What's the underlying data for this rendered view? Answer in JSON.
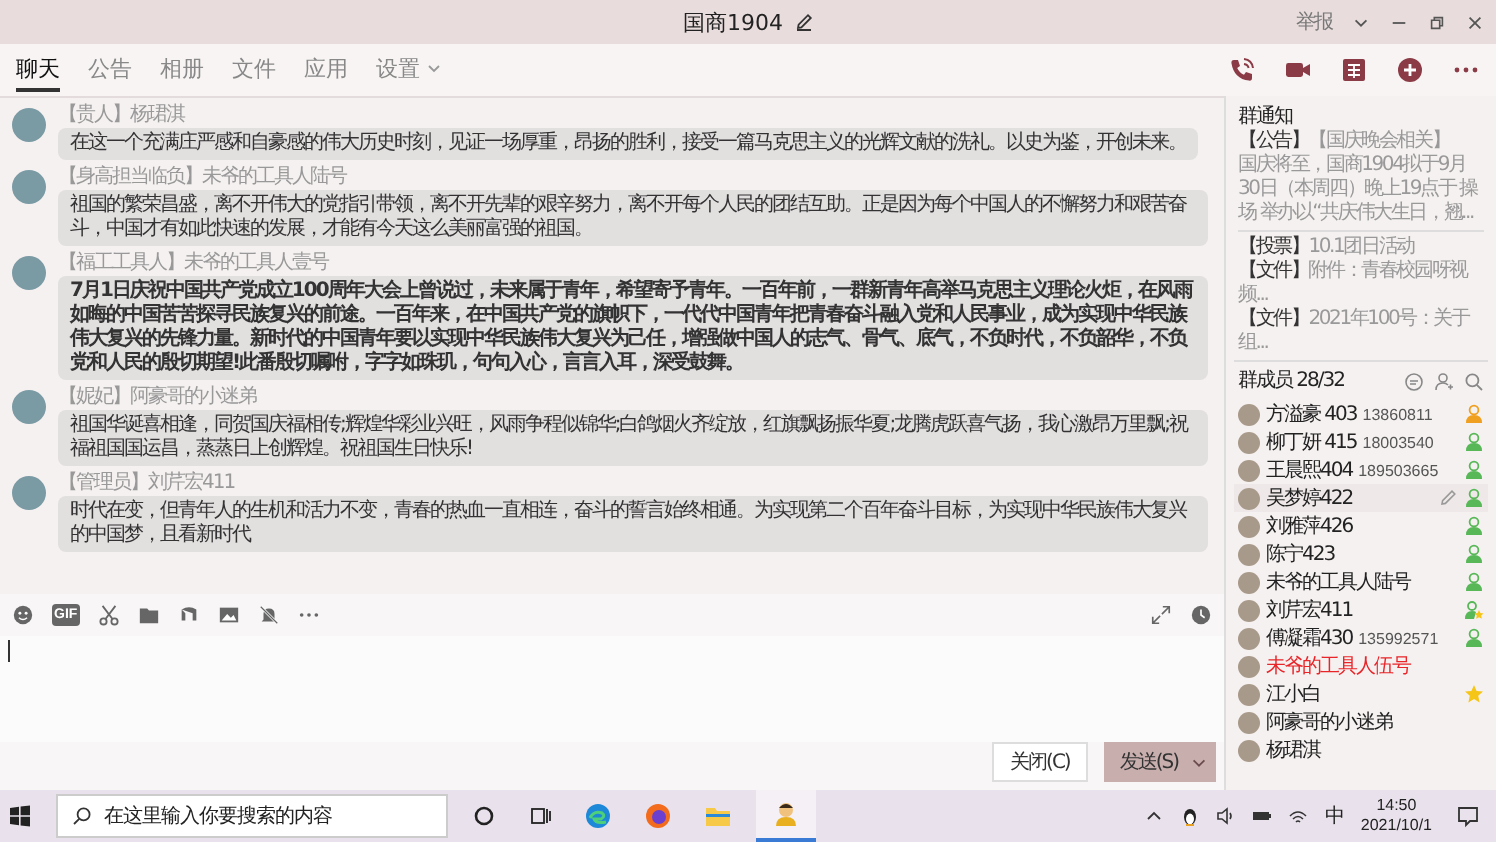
{
  "window": {
    "title": "国商1904",
    "report": "举报"
  },
  "tabs": [
    {
      "label": "聊天",
      "selected": true,
      "dropdown": false
    },
    {
      "label": "公告",
      "selected": false,
      "dropdown": false
    },
    {
      "label": "相册",
      "selected": false,
      "dropdown": false
    },
    {
      "label": "文件",
      "selected": false,
      "dropdown": false
    },
    {
      "label": "应用",
      "selected": false,
      "dropdown": false
    },
    {
      "label": "设置",
      "selected": false,
      "dropdown": true
    }
  ],
  "messages": [
    {
      "sender": "【贵人】杨珺淇",
      "text": "在这一个充满庄严感和自豪感的伟大历史时刻，见证一场厚重，昂扬的胜利，接受一篇马克思主义的光辉文献的洗礼。以史为鉴，开创未来。",
      "bold": false
    },
    {
      "sender": "【身高担当临负】未爷的工具人陆号",
      "text": "祖国的繁荣昌盛，离不开伟大的党指引带领，离不开先辈的艰辛努力，离不开每个人民的团结互助。正是因为每个中国人的不懈努力和艰苦奋斗，中国才有如此快速的发展，才能有今天这么美丽富强的祖国。",
      "bold": false
    },
    {
      "sender": "【福工工具人】未爷的工具人壹号",
      "text": "7月1日庆祝中国共产党成立100周年大会上曾说过，未来属于青年，希望寄予青年。一百年前，一群新青年高举马克思主义理论火炬，在风雨如晦的中国苦苦探寻民族复兴的前途。一百年来，在中国共产党的旗帜下，一代代中国青年把青春奋斗融入党和人民事业，成为实现中华民族伟大复兴的先锋力量。新时代的中国青年要以实现中华民族伟大复兴为己任，增强做中国人的志气、骨气、底气，不负时代，不负韶华，不负党和人民的殷切期望!此番殷切嘱咐，字字如珠玑，句句入心，言言入耳，深受鼓舞。",
      "bold": true
    },
    {
      "sender": "【妮妃】阿豪哥的小迷弟",
      "text": "祖国华诞喜相逢，同贺国庆福相传;辉煌华彩业兴旺，风雨争程似锦华;白鸽烟火齐绽放，红旗飘扬振华夏;龙腾虎跃喜气扬，我心激昂万里飘;祝福祖国国运昌，蒸蒸日上创辉煌。祝祖国生日快乐!",
      "bold": false
    },
    {
      "sender": "【管理员】刘芹宏411",
      "text": "时代在变，但青年人的生机和活力不变，青春的热血一直相连，奋斗的誓言始终相通。为实现第二个百年奋斗目标，为实现中华民族伟大复兴的中国梦，且看新时代",
      "bold": false
    }
  ],
  "composer": {
    "gif_label": "GIF",
    "close_button": "关闭(C)",
    "send_button": "发送(S)"
  },
  "group_notice": {
    "title": "群通知",
    "items": [
      {
        "tag": "【公告】",
        "title": "【国庆晚会相关】",
        "body": "国庆将至，国商1904拟于9月30日（本周四）晚上19点于 操场 举办以“共庆伟大生日，翘..."
      },
      {
        "tag": "【投票】",
        "title": "10.1团日活动"
      },
      {
        "tag": "【文件】",
        "title": "附件：青春校园呀视频..."
      },
      {
        "tag": "【文件】",
        "title": "2021年100号：关于组..."
      }
    ]
  },
  "members": {
    "title": "群成员 28/32",
    "list": [
      {
        "name": "方溢豪 403",
        "phone": "13860811",
        "kind": "owner",
        "hovered": false,
        "highlighted": false
      },
      {
        "name": "柳丁妍 415",
        "phone": "18003540",
        "kind": "member",
        "hovered": false,
        "highlighted": false
      },
      {
        "name": "王晨熙404",
        "phone": "189503665",
        "kind": "member",
        "hovered": false,
        "highlighted": false
      },
      {
        "name": "吴梦婷422",
        "kind": "member",
        "hovered": true,
        "highlighted": false
      },
      {
        "name": "刘雅萍426",
        "kind": "member",
        "hovered": false,
        "highlighted": false
      },
      {
        "name": "陈宁423",
        "kind": "member",
        "hovered": false,
        "highlighted": false
      },
      {
        "name": "未爷的工具人陆号",
        "kind": "member",
        "hovered": false,
        "highlighted": false
      },
      {
        "name": "刘芹宏411",
        "kind": "admin",
        "hovered": false,
        "highlighted": false
      },
      {
        "name": "傅凝霜430",
        "phone": "135992571",
        "kind": "member",
        "hovered": false,
        "highlighted": false
      },
      {
        "name": "未爷的工具人伍号",
        "kind": "none",
        "hovered": false,
        "highlighted": true
      },
      {
        "name": "江小白",
        "kind": "star",
        "hovered": false,
        "highlighted": false
      },
      {
        "name": "阿豪哥的小迷弟",
        "kind": "none",
        "hovered": false,
        "highlighted": false
      },
      {
        "name": "杨珺淇",
        "kind": "none",
        "hovered": false,
        "highlighted": false
      }
    ]
  },
  "taskbar": {
    "search_placeholder": "在这里输入你要搜索的内容",
    "ime": "中",
    "time": "14:50",
    "date": "2021/10/1"
  }
}
